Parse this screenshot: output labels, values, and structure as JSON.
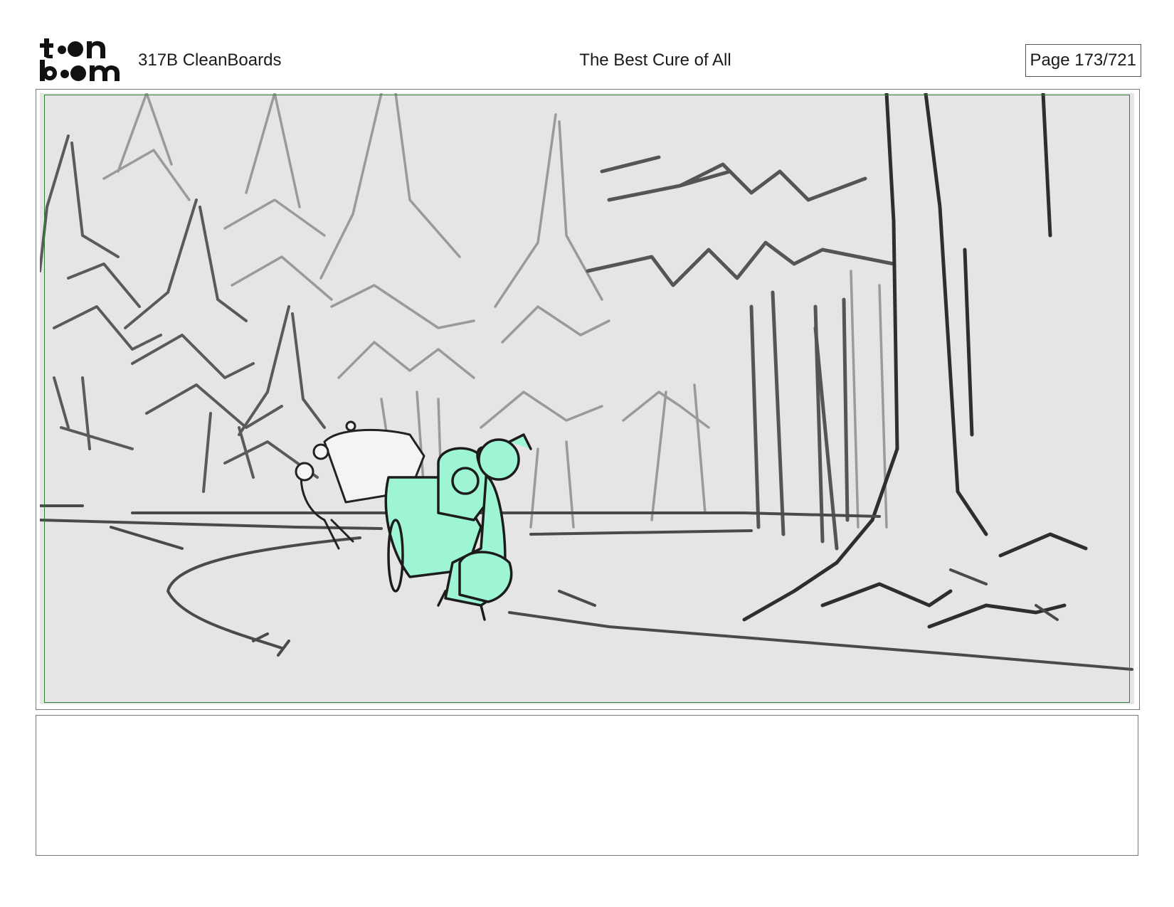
{
  "header": {
    "logo_text_top": "toon",
    "logo_text_bottom": "boom",
    "project": "317B  CleanBoards",
    "title": "The Best Cure of All",
    "page": "Page 173/721"
  },
  "panel": {
    "description_text": "",
    "highlight_color": "#9ef5d4",
    "safe_frame_color": "#2f7d32",
    "background_color": "#e5e5e5"
  },
  "icons": {
    "logo": "toonboom-logo"
  }
}
